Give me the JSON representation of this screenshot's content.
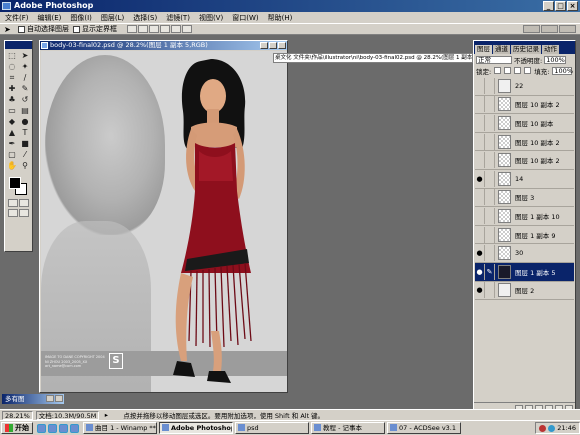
{
  "window": {
    "title": "Adobe Photoshop"
  },
  "menu": [
    "文件(F)",
    "编辑(E)",
    "图像(I)",
    "图层(L)",
    "选择(S)",
    "滤镜(T)",
    "视图(V)",
    "窗口(W)",
    "帮助(H)"
  ],
  "options": {
    "auto_select_layer": "自动选择图层",
    "show_bounding_box": "显示定界框"
  },
  "document": {
    "title": "body-03-final02.psd @ 28.2%(图层 1 副本 5,RGB)",
    "path_tooltip": "桌文化 文件夹\\作品\\illustrator\\ni\\body-03-final02.psd @ 28.2%(图层 1 副本 5,RGB)",
    "credit_text": "IMAGE TO DANE COPYRIGHT 2004 NI ZHOU 2003_2005_XX art_name@com.com"
  },
  "layers_panel": {
    "tabs": [
      "图层",
      "通道",
      "历史记录",
      "动作"
    ],
    "blend_mode": "正常",
    "opacity_label": "不透明度:",
    "opacity_value": "100%",
    "lock_label": "锁定:",
    "fill_label": "填充:",
    "fill_value": "100%",
    "layers": [
      {
        "name": "22",
        "visible": false,
        "selected": false,
        "thumb": "pale"
      },
      {
        "name": "图层 10 副本 2",
        "visible": false,
        "selected": false,
        "thumb": "check"
      },
      {
        "name": "图层 10 副本",
        "visible": false,
        "selected": false,
        "thumb": "check"
      },
      {
        "name": "图层 10 副本 2",
        "visible": false,
        "selected": false,
        "thumb": "check"
      },
      {
        "name": "图层 10 副本 2",
        "visible": false,
        "selected": false,
        "thumb": "check"
      },
      {
        "name": "14",
        "visible": true,
        "selected": false,
        "thumb": "check"
      },
      {
        "name": "图层 3",
        "visible": false,
        "selected": false,
        "thumb": "check"
      },
      {
        "name": "图层 1 副本 10",
        "visible": false,
        "selected": false,
        "thumb": "check"
      },
      {
        "name": "图层 1 副本 9",
        "visible": false,
        "selected": false,
        "thumb": "check"
      },
      {
        "name": "30",
        "visible": true,
        "selected": false,
        "thumb": "check"
      },
      {
        "name": "图层 1 副本 5",
        "visible": true,
        "selected": true,
        "thumb": "dark"
      },
      {
        "name": "图层 2",
        "visible": true,
        "selected": false,
        "thumb": "pale"
      }
    ]
  },
  "mini_palette": {
    "title": "多有图"
  },
  "status": {
    "zoom": "28.21%",
    "doc_size": "文档:10.3M/90.5M",
    "hint": "点按并拖移以移动图层或选区。要用附加选项，使用 Shift 和 Alt 键。"
  },
  "taskbar": {
    "start": "开始",
    "tasks": [
      "曲目 1 - Winamp *** 1...",
      "Adobe Photoshop",
      "psd",
      "教程 - 记事本",
      "07 - ACDSee v3.1"
    ],
    "active_task": 1,
    "clock": "21:46"
  }
}
